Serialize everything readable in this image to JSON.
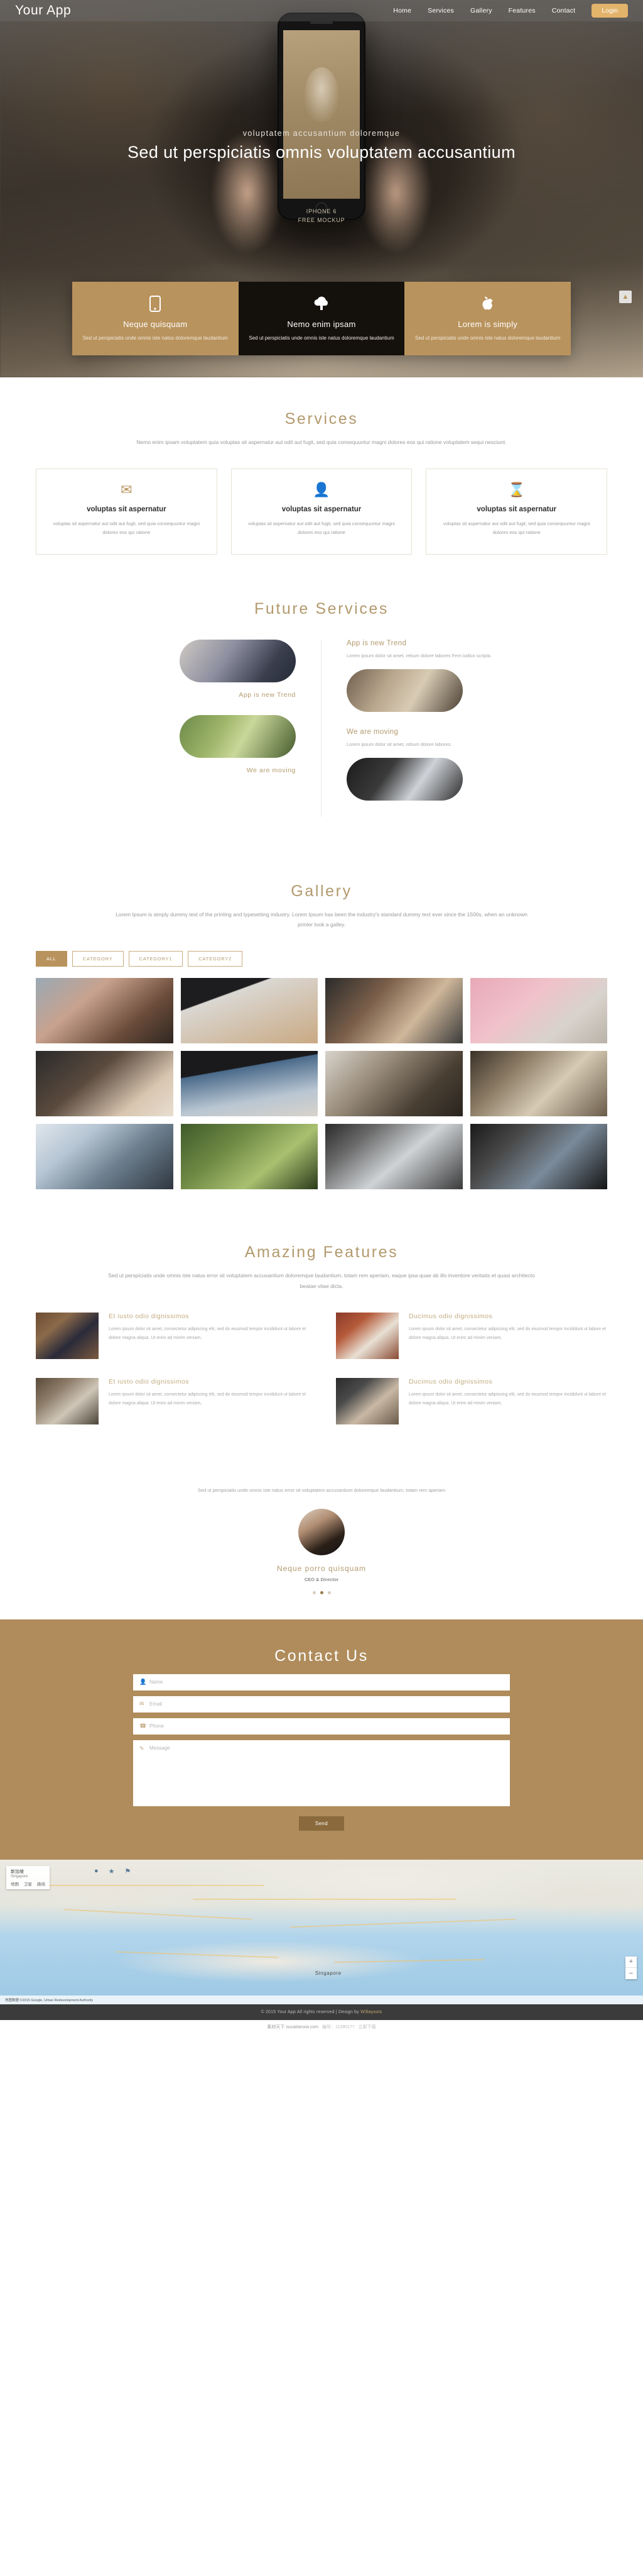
{
  "nav": {
    "logo": "Your App",
    "links": [
      {
        "label": "Home"
      },
      {
        "label": "Services"
      },
      {
        "label": "Gallery"
      },
      {
        "label": "Features"
      },
      {
        "label": "Contact"
      }
    ],
    "login_label": "Login",
    "accent_color": "#e2b36a"
  },
  "hero": {
    "subtitle": "voluptatem accusantium doloremque",
    "title": "Sed ut perspiciatis omnis voluptatem accusantium",
    "phone_caption_line1": "IPHONE 6",
    "phone_caption_line2": "FREE MOCKUP",
    "scroll_top_icon": "chevron-up-icon",
    "boxes": [
      {
        "icon": "mobile-phone-icon",
        "title": "Neque quisquam",
        "desc": "Sed ut perspiciatis unde omnis iste natus doloremque laudantium",
        "style": "tan"
      },
      {
        "icon": "cloud-upload-icon",
        "title": "Nemo enim ipsam",
        "desc": "Sed ut perspiciatis unde omnis iste natus doloremque laudantium",
        "style": "dark"
      },
      {
        "icon": "apple-icon",
        "title": "Lorem is simply",
        "desc": "Sed ut perspiciatis unde omnis iste natus doloremque laudantium",
        "style": "tan"
      }
    ]
  },
  "services": {
    "title": "Services",
    "subtitle": "Nemo enim ipsam voluptatem quia voluptas sit aspernatur aut odit aut fugit, sed quia consequuntur magni dolores eos qui ratione voluptatem sequi nesciunt.",
    "cards": [
      {
        "icon": "envelope-icon",
        "title": "voluptas sit aspernatur",
        "desc": "voluptas sit aspernatur aut odit aut fugit, sed quia consequuntur magni dolores eos qui ratione"
      },
      {
        "icon": "user-icon",
        "title": "voluptas sit aspernatur",
        "desc": "voluptas sit aspernatur aut odit aut fugit, sed quia consequuntur magni dolores eos qui ratione"
      },
      {
        "icon": "hourglass-icon",
        "title": "voluptas sit aspernatur",
        "desc": "voluptas sit aspernatur aut odit aut fugit, sed quia consequuntur magni dolores eos qui ratione"
      }
    ]
  },
  "future_services": {
    "title": "Future Services",
    "left": [
      {
        "label": "App is new Trend"
      },
      {
        "label": "We are moving"
      }
    ],
    "right": [
      {
        "heading": "App is new Trend",
        "text": "Lorem ipsum dolor sit amet, rebum dolore labores Ferri iudico scripta."
      },
      {
        "heading": "We are moving",
        "text": "Lorem ipsum dolor sit amet, rebum dolore labores."
      }
    ]
  },
  "gallery": {
    "title": "Gallery",
    "subtitle": "Lorem Ipsum is simply dummy text of the printing and typesetting industry. Lorem Ipsum has been the industry's standard dummy text ever since the 1500s, when an unknown printer took a galley.",
    "filters": [
      {
        "label": "ALL",
        "active": true
      },
      {
        "label": "CATEGORY",
        "active": false
      },
      {
        "label": "CATEGORY1",
        "active": false
      },
      {
        "label": "CATEGORY2",
        "active": false
      }
    ],
    "items": [
      {
        "name": "gallery-image-1"
      },
      {
        "name": "gallery-image-2"
      },
      {
        "name": "gallery-image-3"
      },
      {
        "name": "gallery-image-4"
      },
      {
        "name": "gallery-image-5"
      },
      {
        "name": "gallery-image-6"
      },
      {
        "name": "gallery-image-7"
      },
      {
        "name": "gallery-image-8"
      },
      {
        "name": "gallery-image-9"
      },
      {
        "name": "gallery-image-10"
      },
      {
        "name": "gallery-image-11"
      },
      {
        "name": "gallery-image-12"
      }
    ]
  },
  "features": {
    "title": "Amazing Features",
    "subtitle": "Sed ut perspiciatis unde omnis iste natus error sit voluptatem accusantium doloremque laudantium, totam rem aperiam, eaque ipsa quae ab illo inventore veritatis et quasi architecto beatae vitae dicta.",
    "items": [
      {
        "title": "Et iusto odio dignissimos",
        "text": "Lorem ipsum dolor sit amet, consectetur adipiscing elit, sed do eiusmod tempor incididunt ut labore et dolore magna aliqua. Ut enim ad minim veniam,"
      },
      {
        "title": "Ducimus odio dignissimos",
        "text": "Lorem ipsum dolor sit amet, consectetur adipiscing elit, sed do eiusmod tempor incididunt ut labore et dolore magna aliqua. Ut enim ad minim veniam,"
      },
      {
        "title": "Et iusto odio dignissimos",
        "text": "Lorem ipsum dolor sit amet, consectetur adipiscing elit, sed do eiusmod tempor incididunt ut labore et dolore magna aliqua. Ut enim ad minim veniam,"
      },
      {
        "title": "Ducimus odio dignissimos",
        "text": "Lorem ipsum dolor sit amet, consectetur adipiscing elit, sed do eiusmod tempor incididunt ut labore et dolore magna aliqua. Ut enim ad minim veniam,"
      }
    ]
  },
  "testimonial": {
    "quote": "Sed ut perspiciatis unde omnis iste natus error sit voluptatem accusantium doloremque laudantium, totam rem aperiam",
    "name": "Neque porro quisquam",
    "role": "CEO & Director",
    "dots": 3,
    "active_dot": 1
  },
  "contact": {
    "title": "Contact Us",
    "fields": [
      {
        "icon": "user-icon",
        "placeholder": "Name",
        "value": ""
      },
      {
        "icon": "envelope-icon",
        "placeholder": "Email",
        "value": ""
      },
      {
        "icon": "phone-icon",
        "placeholder": "Phone",
        "value": ""
      }
    ],
    "message_icon": "pencil-icon",
    "message_placeholder": "Message",
    "message_value": "",
    "send_label": "Send",
    "background_color": "#b08c5c"
  },
  "map": {
    "search_value": "新加坡",
    "search_sub": "Singapore",
    "tabs": [
      "地图",
      "卫星",
      "路线"
    ],
    "city_label": "Singapore",
    "attribution": "地图数据 ©2015 Google, Urban Redevelopment Authority",
    "zoom_in": "+",
    "zoom_out": "−"
  },
  "footer": {
    "text": "© 2015 Your App All rights reserved | Design by",
    "link": "W3layouts"
  },
  "credit": {
    "site": "素材天下 sucaitianxia.com",
    "id_label": "编号：11390177",
    "download": "立即下载"
  }
}
